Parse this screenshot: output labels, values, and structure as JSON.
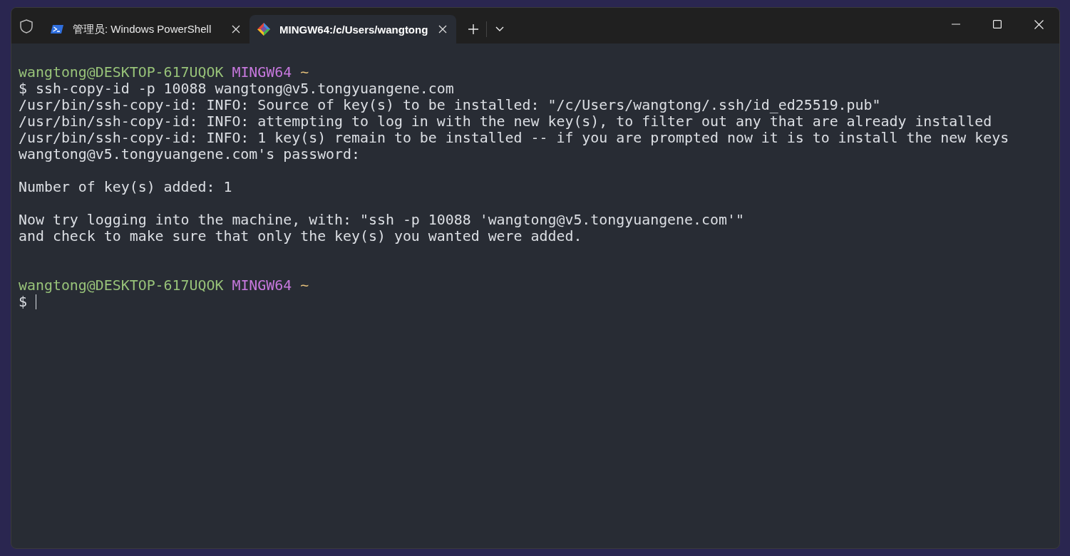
{
  "tabs": [
    {
      "title": "管理员: Windows PowerShell",
      "selected": false
    },
    {
      "title": "MINGW64:/c/Users/wangtong",
      "selected": true
    }
  ],
  "terminal": {
    "lines": [
      {
        "kind": "header",
        "segments": [
          {
            "kind": "user",
            "text": "wangtong@DESKTOP-617UQOK"
          },
          {
            "kind": "env",
            "text": "MINGW64"
          },
          {
            "kind": "path",
            "text": "~"
          }
        ]
      },
      {
        "kind": "text",
        "segments": [
          {
            "kind": "plain",
            "text": "$ ssh-copy-id -p 10088 wangtong@v5.tongyuangene.com"
          }
        ]
      },
      {
        "kind": "text",
        "segments": [
          {
            "kind": "plain",
            "text": "/usr/bin/ssh-copy-id: INFO: Source of key(s) to be installed: \"/c/Users/wangtong/.ssh/id_ed25519.pub\""
          }
        ]
      },
      {
        "kind": "text",
        "segments": [
          {
            "kind": "plain",
            "text": "/usr/bin/ssh-copy-id: INFO: attempting to log in with the new key(s), to filter out any that are already installed"
          }
        ]
      },
      {
        "kind": "text",
        "segments": [
          {
            "kind": "plain",
            "text": "/usr/bin/ssh-copy-id: INFO: 1 key(s) remain to be installed -- if you are prompted now it is to install the new keys"
          }
        ]
      },
      {
        "kind": "text",
        "segments": [
          {
            "kind": "plain",
            "text": "wangtong@v5.tongyuangene.com's password:"
          }
        ]
      },
      {
        "kind": "blank"
      },
      {
        "kind": "text",
        "segments": [
          {
            "kind": "plain",
            "text": "Number of key(s) added: 1"
          }
        ]
      },
      {
        "kind": "blank"
      },
      {
        "kind": "text",
        "segments": [
          {
            "kind": "plain",
            "text": "Now try logging into the machine, with: \"ssh -p 10088 'wangtong@v5.tongyuangene.com'\""
          }
        ]
      },
      {
        "kind": "text",
        "segments": [
          {
            "kind": "plain",
            "text": "and check to make sure that only the key(s) you wanted were added."
          }
        ]
      },
      {
        "kind": "blank"
      },
      {
        "kind": "blank"
      },
      {
        "kind": "header",
        "segments": [
          {
            "kind": "user",
            "text": "wangtong@DESKTOP-617UQOK"
          },
          {
            "kind": "env",
            "text": "MINGW64"
          },
          {
            "kind": "path",
            "text": "~"
          }
        ]
      },
      {
        "kind": "prompt",
        "segments": [
          {
            "kind": "plain",
            "text": "$"
          }
        ]
      }
    ]
  }
}
